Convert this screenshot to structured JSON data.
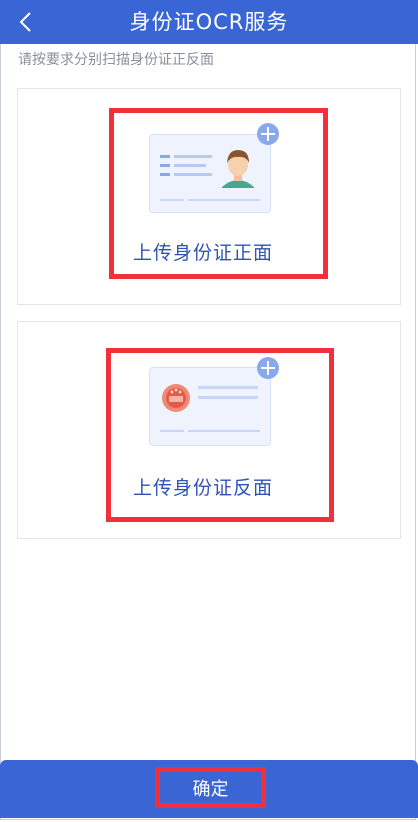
{
  "header": {
    "title": "身份证OCR服务",
    "back_icon": "chevron-left-icon"
  },
  "subtitle": "请按要求分别扫描身份证正反面",
  "front": {
    "label": "上传身份证正面",
    "icon": "id-card-front-icon",
    "add_icon": "plus-icon"
  },
  "back": {
    "label": "上传身份证反面",
    "icon": "id-card-back-icon",
    "add_icon": "plus-icon"
  },
  "footer": {
    "confirm_label": "确定"
  },
  "colors": {
    "primary": "#3a66d5",
    "highlight": "#f0313b",
    "label": "#2f54b7",
    "plus": "#8aa8ec"
  }
}
